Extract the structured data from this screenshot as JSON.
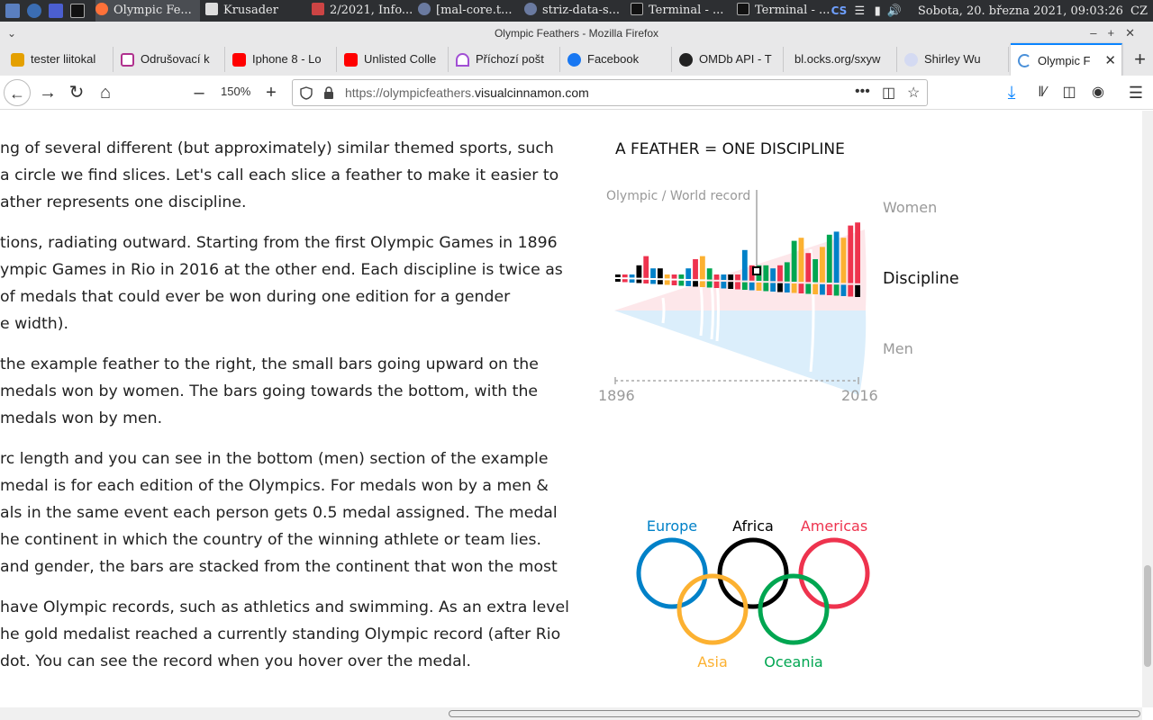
{
  "taskbar": {
    "tasks": [
      {
        "label": "Olympic Fe...",
        "active": true
      },
      {
        "label": "Krusader"
      },
      {
        "label": "2/2021, Info..."
      },
      {
        "label": "[mal-core.t..."
      },
      {
        "label": "striz-data-s..."
      },
      {
        "label": "Terminal - ..."
      },
      {
        "label": "Terminal - ..."
      }
    ],
    "keyboard": "CS",
    "clock": "Sobota, 20. března 2021, 09:03:26",
    "locale": "CZ"
  },
  "window": {
    "title": "Olympic Feathers - Mozilla Firefox"
  },
  "tabs": [
    {
      "label": "tester liitokal",
      "color": "#e4a000"
    },
    {
      "label": "Odrušovací k",
      "color": "#b0318e"
    },
    {
      "label": "Iphone 8 - Lo",
      "color": "#ff0000"
    },
    {
      "label": "Unlisted Colle",
      "color": "#ff0000"
    },
    {
      "label": "Příchozí pošt",
      "color": "#a14fd4"
    },
    {
      "label": "Facebook",
      "color": "#1877f2"
    },
    {
      "label": "OMDb API - T",
      "color": "#222222"
    },
    {
      "label": "bl.ocks.org/sxyw",
      "color": "#ffffff"
    },
    {
      "label": "Shirley Wu",
      "color": "#aab4e8"
    },
    {
      "label": "Olympic F",
      "color": "#4a90d9",
      "active": true
    }
  ],
  "navbar": {
    "zoom": "150%",
    "url_prefix": "https://olympicfeathers.",
    "url_domain": "visualcinnamon.com"
  },
  "article": {
    "paragraphs": [
      [
        "ng of several different (but approximately) similar themed sports, such",
        "a circle we find slices. Let's call each slice a feather to make it easier to",
        "ather represents one discipline."
      ],
      [
        "tions, radiating outward. Starting from the first Olympic Games in 1896",
        "ympic Games in Rio in 2016 at the other end. Each discipline is twice as",
        " of medals that could ever be won during one edition for a gender",
        "e width)."
      ],
      [
        " the example feather to the right, the small bars going upward on the",
        "medals won by women. The bars going towards the bottom, with the",
        " medals won by men."
      ],
      [
        "rc length and you can see in the bottom (men) section of the example",
        " medal is for each edition of the Olympics. For medals won by a men &",
        "als in the same event each person gets 0.5 medal assigned. The medal",
        "he continent in which the country of the winning athlete or team lies.",
        "and gender, the bars are stacked from the continent that won the most",
        ""
      ],
      [
        "have Olympic records, such as athletics and swimming. As an extra level",
        "he gold medalist reached a currently standing Olympic record (after Rio",
        "dot. You can see the record when you hover over the medal."
      ]
    ]
  },
  "legend": {
    "title": "A FEATHER = ONE DISCIPLINE",
    "record_label": "Olympic / World record",
    "women_label": "Women",
    "discipline_label": "Discipline",
    "men_label": "Men",
    "year_start": "1896",
    "year_end": "2016"
  },
  "continents": {
    "europe": {
      "label": "Europe",
      "color": "#0081c8"
    },
    "africa": {
      "label": "Africa",
      "color": "#000000"
    },
    "americas": {
      "label": "Americas",
      "color": "#ee334e"
    },
    "asia": {
      "label": "Asia",
      "color": "#fcb131"
    },
    "oceania": {
      "label": "Oceania",
      "color": "#00a651"
    }
  },
  "feather_bars": {
    "women": [
      0,
      0,
      0,
      0.3,
      0.6,
      0.2,
      0.2,
      0,
      0,
      0,
      0.2,
      0.5,
      0.6,
      0.2,
      0,
      0,
      0,
      0,
      0.8,
      0.3,
      0.3,
      0.3,
      0.2,
      0.3,
      0.4,
      1.1,
      1.2,
      0.7,
      0.5,
      0.9,
      1.3,
      1.4,
      1.2,
      1.6,
      1.7
    ],
    "men_colors": [
      "#000",
      "#ee334e",
      "#0081c8",
      "#000",
      "#ee334e",
      "#0081c8",
      "#000",
      "#fcb131",
      "#ee334e",
      "#00a651",
      "#0081c8",
      "#000",
      "#fcb131",
      "#00a651",
      "#ee334e",
      "#0081c8",
      "#000",
      "#ee334e",
      "#00a651",
      "#0081c8",
      "#fcb131",
      "#00a651",
      "#0081c8",
      "#000",
      "#0081c8",
      "#fcb131",
      "#ee334e",
      "#00a651",
      "#fcb131",
      "#0081c8",
      "#ee334e",
      "#00a651",
      "#0081c8",
      "#ee334e",
      "#000"
    ],
    "women_colors": [
      "#000",
      "#ee334e",
      "#0081c8",
      "#000",
      "#ee334e",
      "#0081c8",
      "#000",
      "#fcb131",
      "#ee334e",
      "#00a651",
      "#0081c8",
      "#ee334e",
      "#fcb131",
      "#00a651",
      "#ee334e",
      "#0081c8",
      "#000",
      "#ee334e",
      "#0081c8",
      "#ee334e",
      "#00a651",
      "#00a651",
      "#0081c8",
      "#ee334e",
      "#00a651",
      "#00a651",
      "#fcb131",
      "#ee334e",
      "#00a651",
      "#fcb131",
      "#00a651",
      "#0081c8",
      "#fcb131",
      "#ee334e",
      "#ee334e"
    ]
  }
}
